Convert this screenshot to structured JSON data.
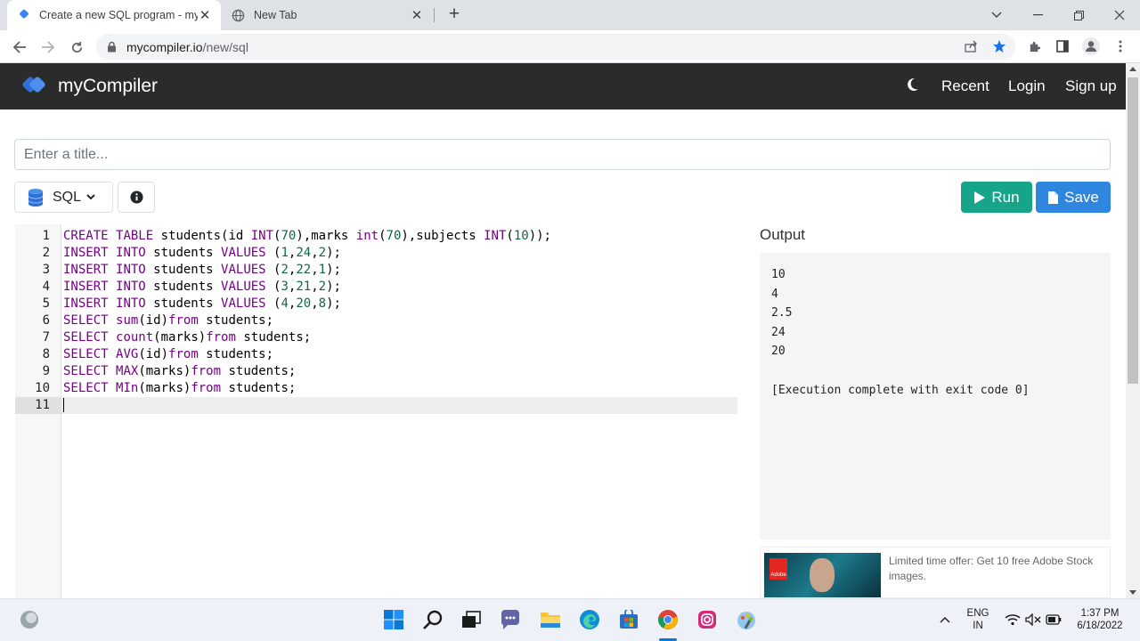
{
  "browser": {
    "tabs": [
      {
        "title": "Create a new SQL program - myC",
        "active": true
      },
      {
        "title": "New Tab",
        "active": false
      }
    ],
    "url_host": "mycompiler.io",
    "url_path": "/new/sql"
  },
  "site": {
    "brand": "myCompiler",
    "nav": {
      "recent": "Recent",
      "login": "Login",
      "signup": "Sign up"
    }
  },
  "editor_page": {
    "title_placeholder": "Enter a title...",
    "language": "SQL",
    "run_label": "Run",
    "save_label": "Save",
    "output_title": "Output"
  },
  "code_lines": [
    "CREATE TABLE students(id INT(70),marks int(70),subjects INT(10));",
    "INSERT INTO students VALUES (1,24,2);",
    "INSERT INTO students VALUES (2,22,1);",
    "INSERT INTO students VALUES (3,21,2);",
    "INSERT INTO students VALUES (4,20,8);",
    "SELECT sum(id)from students;",
    "SELECT count(marks)from students;",
    "SELECT AVG(id)from students;",
    "SELECT MAX(marks)from students;",
    "SELECT MIn(marks)from students;",
    ""
  ],
  "active_line": 11,
  "output_lines": [
    "10",
    "4",
    "2.5",
    "24",
    "20",
    "",
    "[Execution complete with exit code 0]"
  ],
  "ad": {
    "text": "Limited time offer: Get 10 free Adobe Stock images.",
    "logo_text": "Adobe"
  },
  "taskbar": {
    "lang": "ENG",
    "region": "IN",
    "time": "1:37 PM",
    "date": "6/18/2022"
  },
  "colors": {
    "header_bg": "#2b2b2b",
    "run": "#17a589",
    "save": "#2e86de",
    "keyword": "#770088",
    "number": "#116644"
  }
}
